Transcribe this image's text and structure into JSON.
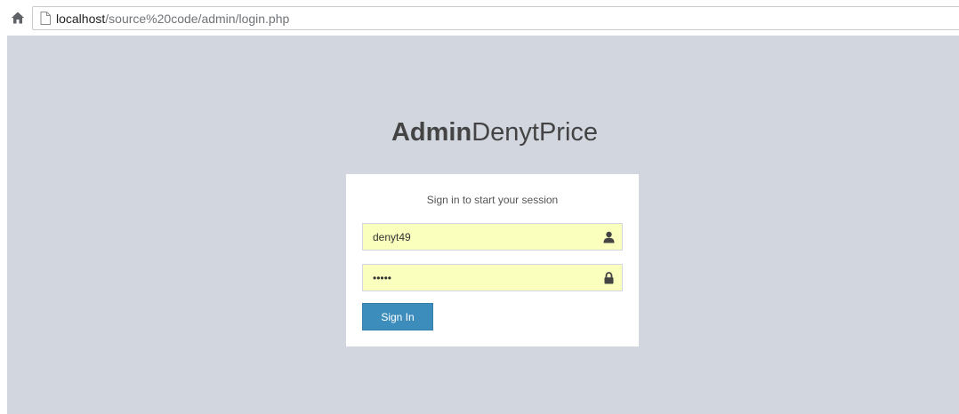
{
  "browser": {
    "url_host": "localhost",
    "url_path": "/source%20code/admin/login.php",
    "icons": [
      "home-icon",
      "page-icon"
    ]
  },
  "login": {
    "logo_bold": "Admin",
    "logo_light": "DenytPrice",
    "message": "Sign in to start your session",
    "username_value": "denyt49",
    "password_value": "*****",
    "username_icon": "user-icon",
    "password_icon": "lock-icon",
    "submit_label": "Sign In"
  },
  "colors": {
    "page_background": "#d2d6de",
    "autofill_background": "#faffbd",
    "button_primary": "#3c8dbc"
  }
}
